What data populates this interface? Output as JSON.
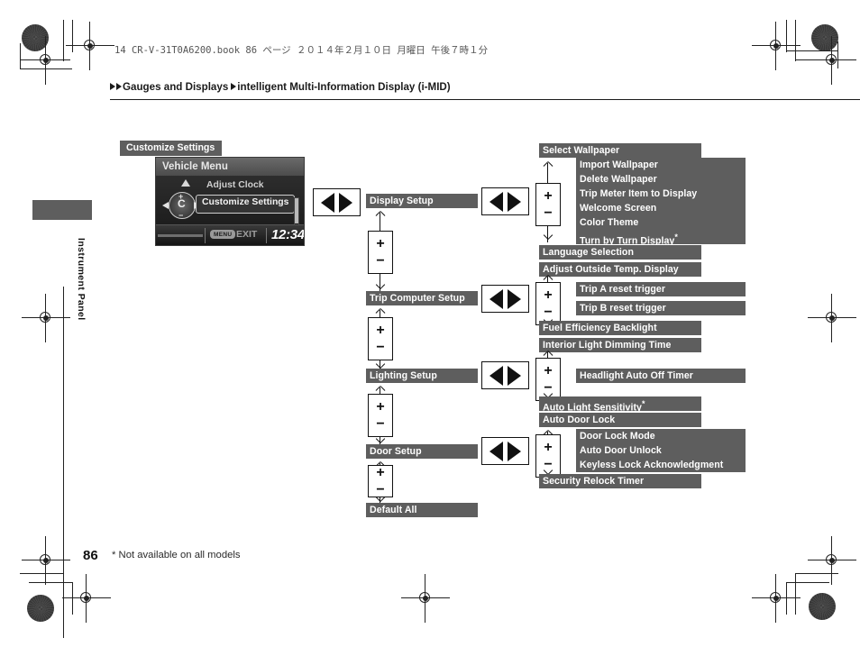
{
  "page": {
    "file_header": "14 CR-V-31T0A6200.book   86 ページ   ２０１４年２月１０日   月曜日   午後７時１分",
    "breadcrumb": "Gauges and Displays intelligent Multi-Information Display (i-MID)",
    "breadcrumb_part1": "Gauges and Displays",
    "breadcrumb_part2": "intelligent Multi-Information Display (i-MID)",
    "side_tab_label": "Instrument Panel",
    "page_number": "86",
    "footnote": "* Not available on all models"
  },
  "colors": {
    "bar_fill": "#5e5e5e",
    "bar_text": "#ffffff",
    "ink": "#111111",
    "rule": "#1b1b1b"
  },
  "mid_screen": {
    "chip_label": "Customize Settings",
    "title": "Vehicle Menu",
    "item_unselected": "Adjust Clock",
    "item_selected": "Customize Settings",
    "menu_button_label": "MENU",
    "exit_label": "EXIT",
    "clock": "12:34",
    "knob_letter": "C",
    "knob_plus": "+",
    "knob_minus": "−"
  },
  "controls": {
    "plus": "+",
    "minus": "−",
    "left_arrow_icon": "triangle-left",
    "right_arrow_icon": "triangle-right"
  },
  "columns": {
    "level1": [
      {
        "label": "Display Setup"
      },
      {
        "label": "Trip Computer Setup"
      },
      {
        "label": "Lighting Setup"
      },
      {
        "label": "Door Setup"
      },
      {
        "label": "Default All"
      }
    ],
    "level2": [
      {
        "label": "Select Wallpaper",
        "indent": "outer",
        "star": false
      },
      {
        "label": "Import Wallpaper",
        "indent": "inner",
        "star": false
      },
      {
        "label": "Delete Wallpaper",
        "indent": "inner",
        "star": false
      },
      {
        "label": "Trip Meter Item to Display",
        "indent": "inner",
        "star": false
      },
      {
        "label": "Welcome Screen",
        "indent": "inner",
        "star": false
      },
      {
        "label": "Color Theme",
        "indent": "inner",
        "star": false
      },
      {
        "label": "Turn by Turn Display",
        "indent": "inner",
        "star": true
      },
      {
        "label": "Language Selection",
        "indent": "outer",
        "star": false
      },
      {
        "label": "Adjust Outside Temp. Display",
        "indent": "outer",
        "star": false
      },
      {
        "label": "Trip A reset trigger",
        "indent": "inner",
        "star": false
      },
      {
        "label": "Trip B reset trigger",
        "indent": "inner",
        "star": false
      },
      {
        "label": "Fuel Efficiency Backlight",
        "indent": "outer",
        "star": false
      },
      {
        "label": "Interior Light Dimming Time",
        "indent": "outer",
        "star": false
      },
      {
        "label": "Headlight Auto Off Timer",
        "indent": "inner",
        "star": false
      },
      {
        "label": "Auto Light Sensitivity",
        "indent": "outer",
        "star": true
      },
      {
        "label": "Auto Door Lock",
        "indent": "outer",
        "star": false
      },
      {
        "label": "Door Lock Mode",
        "indent": "inner",
        "star": false
      },
      {
        "label": "Auto Door Unlock",
        "indent": "inner",
        "star": false
      },
      {
        "label": "Keyless Lock Acknowledgment",
        "indent": "inner",
        "star": false
      },
      {
        "label": "Security Relock Timer",
        "indent": "outer",
        "star": false
      }
    ]
  }
}
